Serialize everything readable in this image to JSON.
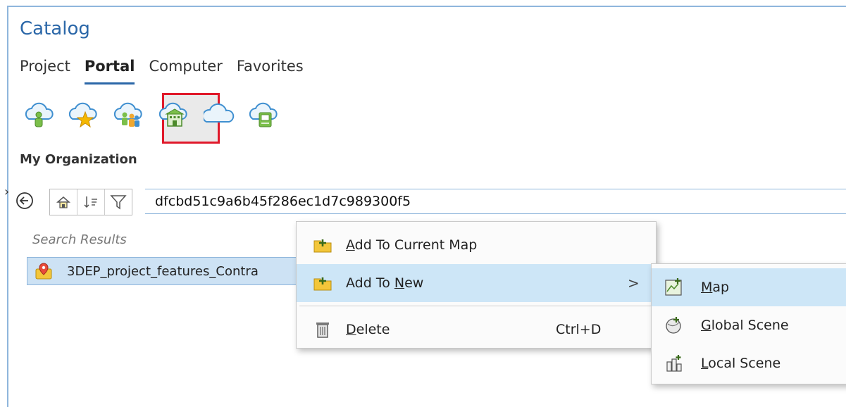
{
  "catalog": {
    "title": "Catalog",
    "tabs": [
      {
        "label": "Project"
      },
      {
        "label": "Portal"
      },
      {
        "label": "Computer"
      },
      {
        "label": "Favorites"
      }
    ],
    "active_tab": "Portal",
    "portal_icons": [
      "my-content-icon",
      "favorites-icon",
      "groups-icon",
      "my-organization-icon",
      "arcgis-online-icon",
      "living-atlas-icon"
    ],
    "section_title": "My Organization",
    "search_value": "dfcbd51c9a6b45f286ec1d7c989300f5",
    "results_label": "Search Results",
    "result_item": "3DEP_project_features_Contra"
  },
  "context_menu": {
    "add_current": {
      "pre": "",
      "ul": "A",
      "post": "dd To Current Map"
    },
    "add_new": {
      "pre": "Add To ",
      "ul": "N",
      "post": "ew"
    },
    "delete": {
      "pre": "",
      "ul": "D",
      "post": "elete"
    },
    "delete_shortcut": "Ctrl+D",
    "submenu_arrow": ">"
  },
  "submenu": {
    "map": {
      "pre": "",
      "ul": "M",
      "post": "ap"
    },
    "global_scene": {
      "pre": "",
      "ul": "G",
      "post": "lobal Scene"
    },
    "local_scene": {
      "pre": "",
      "ul": "L",
      "post": "ocal Scene"
    }
  },
  "colors": {
    "accent": "#2b67a8",
    "highlight": "#cde6f7",
    "selection_box": "#e0192a"
  }
}
